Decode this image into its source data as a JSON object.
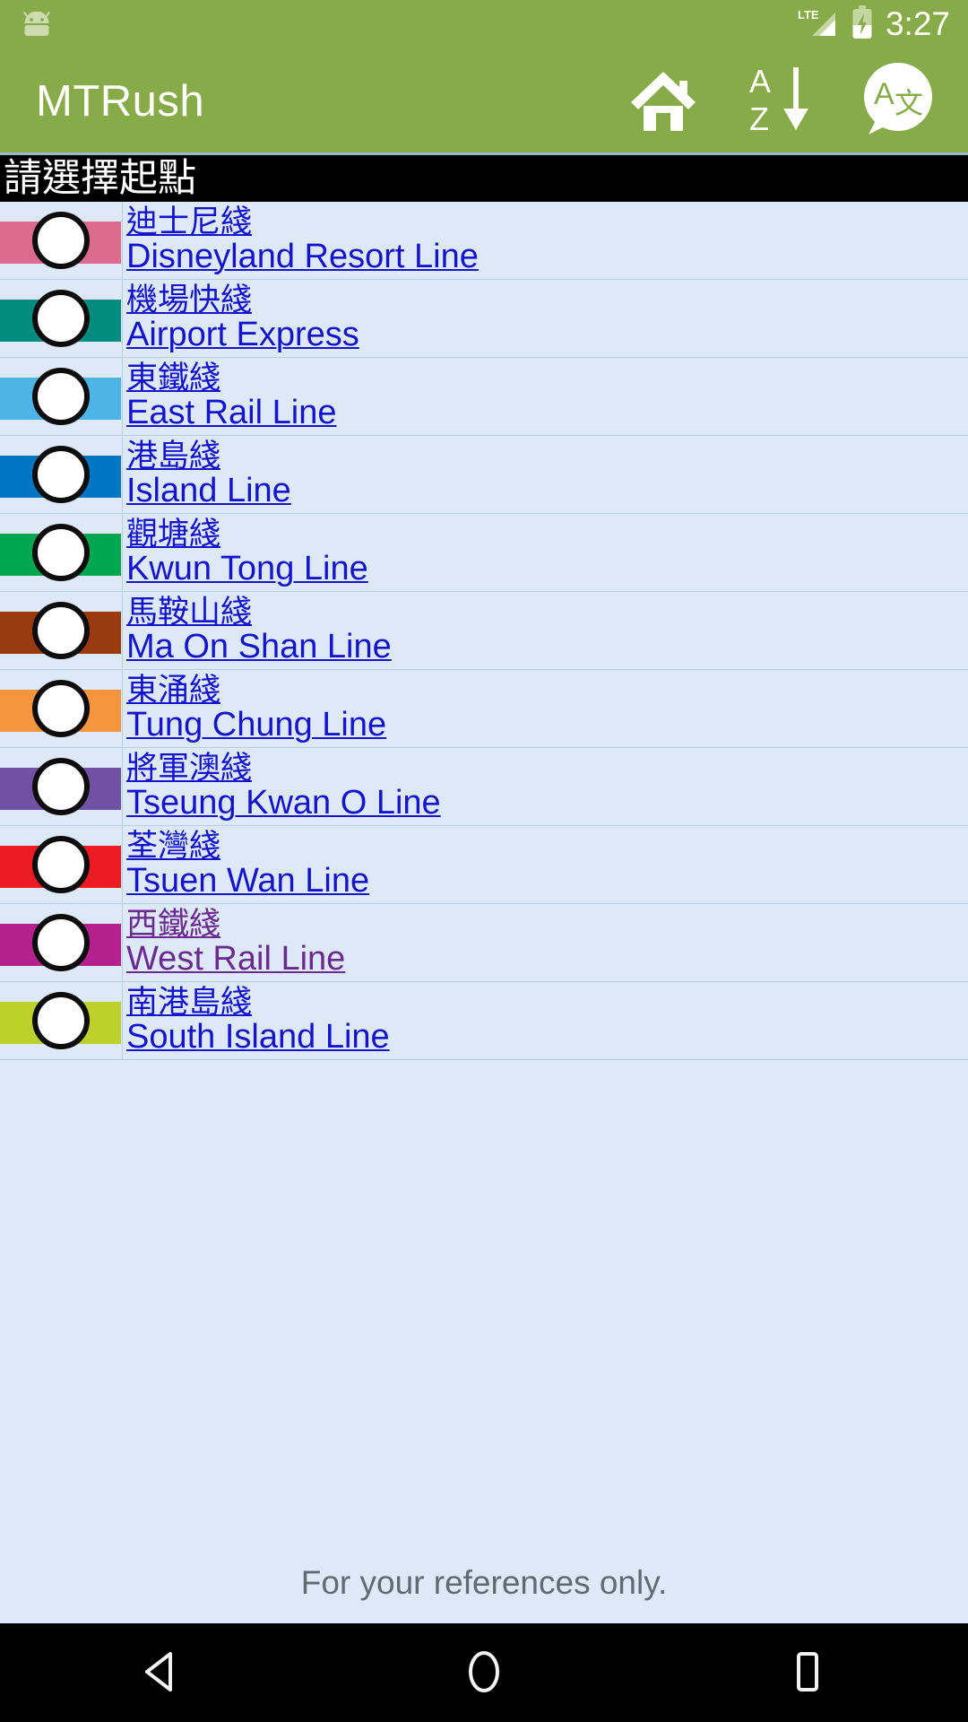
{
  "status_bar": {
    "notification_icon": "android-head-icon",
    "network_label": "LTE",
    "signal_icon": "signal-bars-icon",
    "battery_icon": "battery-charging-icon",
    "clock": "3:27",
    "background_color": "#87ab49"
  },
  "app_bar": {
    "title": "MTRush",
    "background_color": "#87ab49",
    "actions": [
      {
        "name": "home-button",
        "icon": "home-icon"
      },
      {
        "name": "sort-button",
        "icon": "sort-az-descending-icon",
        "top_letter": "A",
        "bottom_letter": "Z"
      },
      {
        "name": "translate-button",
        "icon": "translate-speech-bubble-icon",
        "latin_glyph": "A",
        "cjk_glyph": "文"
      }
    ]
  },
  "section_header": {
    "title": "請選擇起點",
    "background_color": "#000000",
    "text_color": "#ffffff"
  },
  "list": {
    "background_color": "#dee9f7",
    "link_color": "#1414cc",
    "visited_link_color": "#6a2a8f",
    "items": [
      {
        "zh": "迪士尼綫",
        "en": "Disneyland Resort Line",
        "color": "#dd6b8e",
        "visited": false
      },
      {
        "zh": "機場快綫",
        "en": "Airport Express",
        "color": "#018c7f",
        "visited": false
      },
      {
        "zh": "東鐵綫",
        "en": "East Rail Line",
        "color": "#4cb4e7",
        "visited": false
      },
      {
        "zh": "港島綫",
        "en": "Island Line",
        "color": "#0075c2",
        "visited": false
      },
      {
        "zh": "觀塘綫",
        "en": "Kwun Tong Line",
        "color": "#00a650",
        "visited": false
      },
      {
        "zh": "馬鞍山綫",
        "en": "Ma On Shan Line",
        "color": "#9a3b0f",
        "visited": false
      },
      {
        "zh": "東涌綫",
        "en": "Tung Chung Line",
        "color": "#f7943e",
        "visited": false
      },
      {
        "zh": "將軍澳綫",
        "en": "Tseung Kwan O Line",
        "color": "#7151a1",
        "visited": false
      },
      {
        "zh": "荃灣綫",
        "en": "Tsuen Wan Line",
        "color": "#ed1c24",
        "visited": false
      },
      {
        "zh": "西鐵綫",
        "en": "West Rail Line",
        "color": "#b5208f",
        "visited": true
      },
      {
        "zh": "南港島綫",
        "en": "South Island Line",
        "color": "#bdd02b",
        "visited": false
      }
    ]
  },
  "footer": {
    "note": "For your references only.",
    "text_color": "#5f6b72"
  },
  "nav_bar": {
    "background_color": "#000000",
    "buttons": [
      {
        "name": "back-button",
        "icon": "triangle-back-icon"
      },
      {
        "name": "home-button",
        "icon": "circle-home-icon"
      },
      {
        "name": "recents-button",
        "icon": "square-recents-icon"
      }
    ]
  }
}
